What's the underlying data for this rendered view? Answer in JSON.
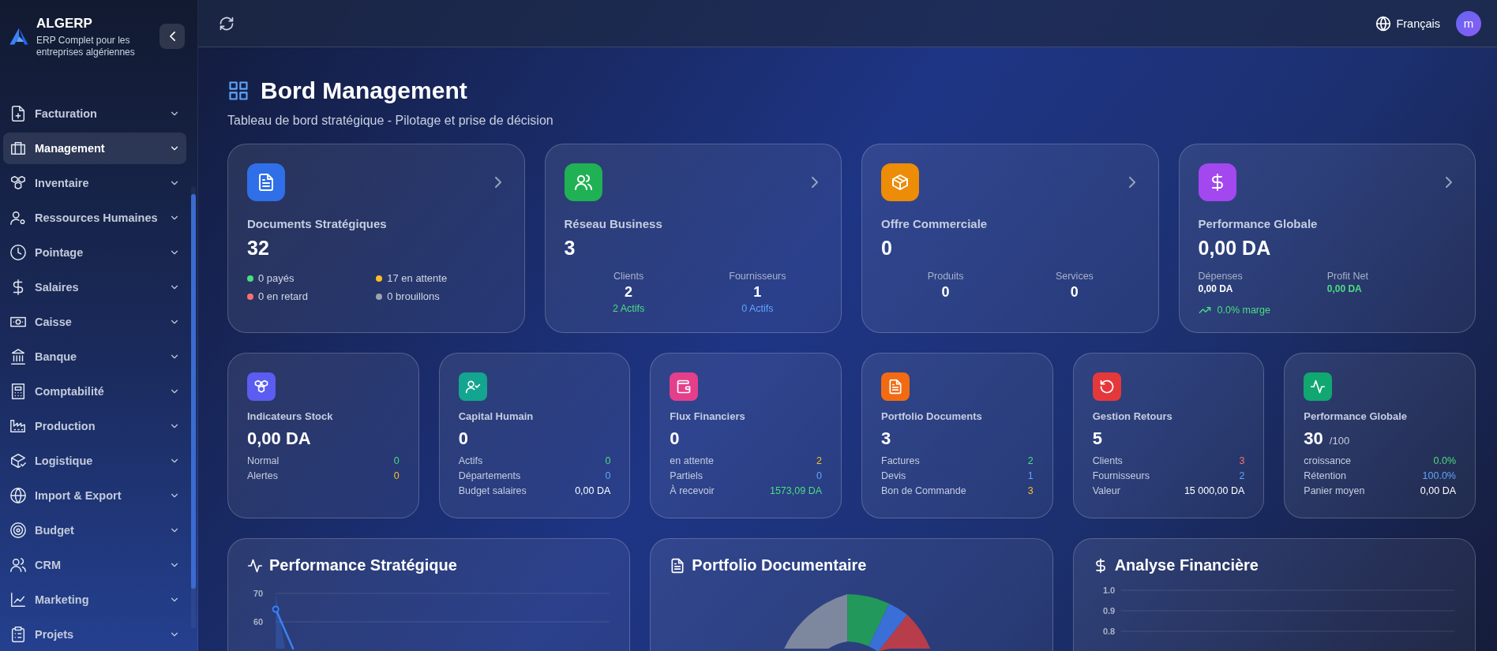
{
  "sidebar": {
    "brand": "ALGERP",
    "tagline": "ERP Complet pour les entreprises algériennes",
    "items": [
      {
        "label": "Facturation",
        "selected": false
      },
      {
        "label": "Management",
        "selected": true
      },
      {
        "label": "Inventaire",
        "selected": false
      },
      {
        "label": "Ressources Humaines",
        "selected": false
      },
      {
        "label": "Pointage",
        "selected": false
      },
      {
        "label": "Salaires",
        "selected": false
      },
      {
        "label": "Caisse",
        "selected": false
      },
      {
        "label": "Banque",
        "selected": false
      },
      {
        "label": "Comptabilité",
        "selected": false
      },
      {
        "label": "Production",
        "selected": false
      },
      {
        "label": "Logistique",
        "selected": false
      },
      {
        "label": "Import & Export",
        "selected": false
      },
      {
        "label": "Budget",
        "selected": false
      },
      {
        "label": "CRM",
        "selected": false
      },
      {
        "label": "Marketing",
        "selected": false
      },
      {
        "label": "Projets",
        "selected": false
      }
    ]
  },
  "topbar": {
    "language": "Français",
    "avatar": "m"
  },
  "page": {
    "title": "Bord Management",
    "subtitle": "Tableau de bord stratégique - Pilotage et prise de décision"
  },
  "summary_cards": [
    {
      "kind": "status",
      "color": "#2f6fe8",
      "title": "Documents Stratégiques",
      "value": "32",
      "statuses": [
        {
          "label": "0 payés",
          "color": "#4ade80"
        },
        {
          "label": "17 en attente",
          "color": "#fbbf24"
        },
        {
          "label": "0 en retard",
          "color": "#f87171"
        },
        {
          "label": "0 brouillons",
          "color": "#9ca3af"
        }
      ]
    },
    {
      "kind": "split",
      "color": "#1fb153",
      "title": "Réseau Business",
      "value": "3",
      "columns": [
        {
          "label": "Clients",
          "value": "2",
          "note": "2 Actifs",
          "color": "#4ade80"
        },
        {
          "label": "Fournisseurs",
          "value": "1",
          "note": "0 Actifs",
          "color": "#60a5fa"
        }
      ]
    },
    {
      "kind": "split",
      "color": "#ec8c07",
      "title": "Offre Commerciale",
      "value": "0",
      "columns": [
        {
          "label": "Produits",
          "value": "0"
        },
        {
          "label": "Services",
          "value": "0"
        }
      ]
    },
    {
      "kind": "finance",
      "color": "#a347ef",
      "title": "Performance Globale",
      "value": "0,00 DA",
      "columns": [
        {
          "label": "Dépenses",
          "value": "0,00 DA",
          "color": "#ffffff"
        },
        {
          "label": "Profit Net",
          "value": "0,00 DA",
          "color": "#4ade80"
        }
      ],
      "trend": "0.0% marge"
    }
  ],
  "metric_cards": [
    {
      "color": "#5b5cf0",
      "title": "Indicateurs Stock",
      "value": "0,00 DA",
      "rows": [
        {
          "label": "Normal",
          "value": "0",
          "color": "#4ade80"
        },
        {
          "label": "Alertes",
          "value": "0",
          "color": "#fbbf24"
        }
      ]
    },
    {
      "color": "#13a58f",
      "title": "Capital Humain",
      "value": "0",
      "rows": [
        {
          "label": "Actifs",
          "value": "0",
          "color": "#4ade80"
        },
        {
          "label": "Départements",
          "value": "0",
          "color": "#60a5fa"
        },
        {
          "label": "Budget salaires",
          "value": "0,00 DA",
          "color": "#ffffff"
        }
      ]
    },
    {
      "color": "#e43f8a",
      "title": "Flux Financiers",
      "value": "0",
      "rows": [
        {
          "label": "en attente",
          "value": "2",
          "color": "#fbbf24"
        },
        {
          "label": "Partiels",
          "value": "0",
          "color": "#60a5fa"
        },
        {
          "label": "À recevoir",
          "value": "1573,09 DA",
          "color": "#4ade80"
        }
      ]
    },
    {
      "color": "#f26b12",
      "title": "Portfolio Documents",
      "value": "3",
      "rows": [
        {
          "label": "Factures",
          "value": "2",
          "color": "#4ade80"
        },
        {
          "label": "Devis",
          "value": "1",
          "color": "#60a5fa"
        },
        {
          "label": "Bon de Commande",
          "value": "3",
          "color": "#fbbf24"
        }
      ]
    },
    {
      "color": "#e5383b",
      "title": "Gestion Retours",
      "value": "5",
      "rows": [
        {
          "label": "Clients",
          "value": "3",
          "color": "#f87171"
        },
        {
          "label": "Fournisseurs",
          "value": "2",
          "color": "#60a5fa"
        },
        {
          "label": "Valeur",
          "value": "15 000,00 DA",
          "color": "#ffffff"
        }
      ]
    },
    {
      "color": "#10a870",
      "title": "Performance Globale",
      "value": "30",
      "suffix": "/100",
      "rows": [
        {
          "label": "croissance",
          "value": "0.0%",
          "color": "#4ade80"
        },
        {
          "label": "Rétention",
          "value": "100.0%",
          "color": "#60a5fa"
        },
        {
          "label": "Panier moyen",
          "value": "0,00 DA",
          "color": "#ffffff"
        }
      ]
    }
  ],
  "chart_cards": [
    {
      "kind": "line",
      "title": "Performance Stratégique",
      "tick_labels": [
        "70",
        "60"
      ]
    },
    {
      "kind": "donut",
      "title": "Portfolio Documentaire"
    },
    {
      "kind": "axis",
      "title": "Analyse Financière",
      "tick_labels": [
        "1.0",
        "0.9",
        "0.8"
      ]
    }
  ]
}
